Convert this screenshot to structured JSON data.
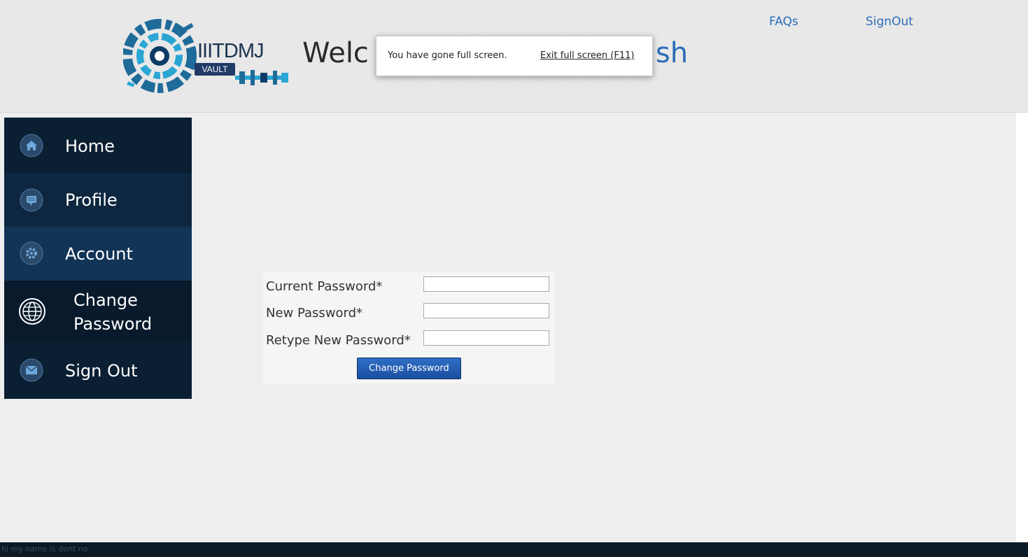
{
  "header": {
    "logo": {
      "title": "IIITDMJ",
      "subtitle": "VAULT"
    },
    "welcome_prefix": "Welc",
    "welcome_suffix": "sh",
    "links": {
      "faqs": "FAQs",
      "signout": "SignOut"
    }
  },
  "fullscreen_notice": {
    "message": "You have gone full screen.",
    "exit_label": "Exit full screen (F11)"
  },
  "sidebar": {
    "items": [
      {
        "label": "Home",
        "icon": "home-icon"
      },
      {
        "label": "Profile",
        "icon": "chat-bubble-icon"
      },
      {
        "label": "Account",
        "icon": "gear-icon"
      },
      {
        "label_line1": "Change",
        "label_line2": "Password",
        "icon": "globe-icon"
      },
      {
        "label": "Sign Out",
        "icon": "envelope-icon"
      }
    ]
  },
  "form": {
    "fields": [
      {
        "label": "Current Password*",
        "value": ""
      },
      {
        "label": "New Password*",
        "value": ""
      },
      {
        "label": "Retype New Password*",
        "value": ""
      }
    ],
    "submit_label": "Change Password"
  },
  "footer": {
    "text": "hi my name is dont no"
  },
  "colors": {
    "sidebar_bg": "#0b1f33",
    "sidebar_active_bg": "#123456",
    "link": "#2a6db8",
    "button": "#1b4fa0"
  }
}
